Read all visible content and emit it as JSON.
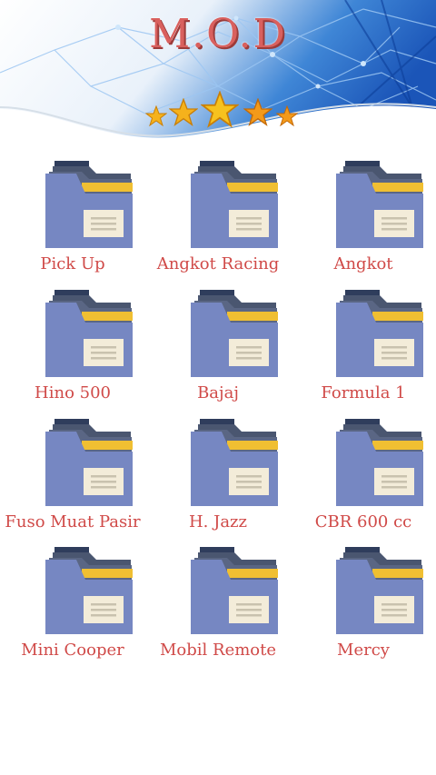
{
  "app": {
    "title": "M.O.D",
    "rating_stars": 5
  },
  "colors": {
    "title": "#d9605e",
    "label": "#d04a48",
    "folder_body": "#7687c2",
    "folder_back": "#4a5670",
    "folder_tab": "#f0bf32",
    "doc": "#f3ecd9",
    "star": "#f5b21c"
  },
  "folders": [
    {
      "label": "Pick Up",
      "icon": "folder-icon"
    },
    {
      "label": "Angkot Racing",
      "icon": "folder-icon"
    },
    {
      "label": "Angkot",
      "icon": "folder-icon"
    },
    {
      "label": "Hino 500",
      "icon": "folder-icon"
    },
    {
      "label": "Bajaj",
      "icon": "folder-icon"
    },
    {
      "label": "Formula 1",
      "icon": "folder-icon"
    },
    {
      "label": "Fuso Muat Pasir",
      "icon": "folder-icon"
    },
    {
      "label": "H. Jazz",
      "icon": "folder-icon"
    },
    {
      "label": "CBR 600 cc",
      "icon": "folder-icon"
    },
    {
      "label": "Mini Cooper",
      "icon": "folder-icon"
    },
    {
      "label": "Mobil Remote",
      "icon": "folder-icon"
    },
    {
      "label": "Mercy",
      "icon": "folder-icon"
    }
  ]
}
